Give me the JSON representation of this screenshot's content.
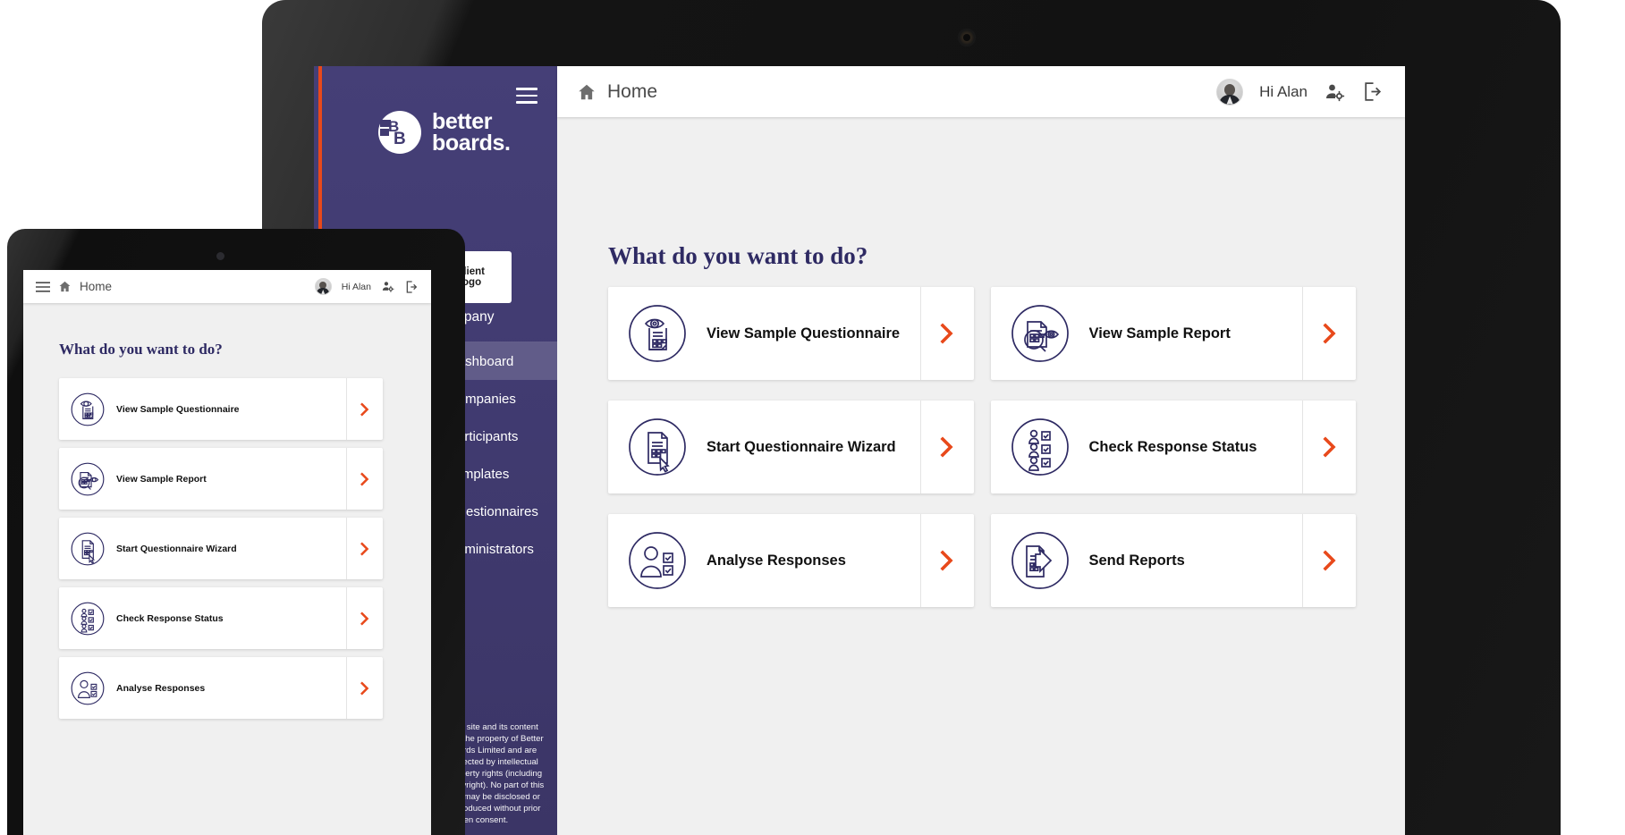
{
  "brand": {
    "name_line1": "better",
    "name_line2": "boards.",
    "mark_letters": "BB",
    "client_logo_label": "Client Logo",
    "accent_color": "#e8491b",
    "sidebar_color": "#413b71",
    "heading_color": "#2e2a63"
  },
  "laptop": {
    "topbar": {
      "breadcrumb": "Home",
      "greeting": "Hi Alan",
      "home_icon": "home-icon",
      "user_settings_icon": "user-settings-icon",
      "logout_icon": "logout-icon",
      "menu_icon": "hamburger-menu-icon"
    },
    "sidebar": {
      "selected_company": "Selected Company",
      "items": [
        {
          "label": "Dashboard",
          "active": true
        },
        {
          "label": "Companies",
          "active": false
        },
        {
          "label": "Participants",
          "active": false
        },
        {
          "label": "Templates",
          "active": false
        },
        {
          "label": "Questionnaires",
          "active": false
        },
        {
          "label": "Administrators",
          "active": false
        }
      ],
      "footer": "This site and its content are the property of Better Boards Limited and are protected by intellectual property rights (including copyright). No part of this site may be disclosed or reproduced without prior written consent."
    },
    "main": {
      "title": "What do you want to do?",
      "cards": [
        {
          "label": "View Sample Questionnaire",
          "icon": "eye-document-icon"
        },
        {
          "label": "View Sample Report",
          "icon": "report-magnifier-eye-icon"
        },
        {
          "label": "Start Questionnaire Wizard",
          "icon": "document-cursor-icon"
        },
        {
          "label": "Check Response Status",
          "icon": "people-checklist-icon"
        },
        {
          "label": "Analyse Responses",
          "icon": "person-checkboxes-icon"
        },
        {
          "label": "Send Reports",
          "icon": "document-arrow-icon"
        }
      ],
      "arrow_icon": "chevron-right-icon"
    }
  },
  "tablet": {
    "topbar": {
      "breadcrumb": "Home",
      "greeting": "Hi Alan",
      "menu_icon": "hamburger-menu-icon",
      "home_icon": "home-icon",
      "user_settings_icon": "user-settings-icon",
      "logout_icon": "logout-icon"
    },
    "main": {
      "title": "What do you want to do?",
      "cards": [
        {
          "label": "View Sample Questionnaire",
          "icon": "eye-document-icon"
        },
        {
          "label": "View Sample Report",
          "icon": "report-magnifier-eye-icon"
        },
        {
          "label": "Start Questionnaire Wizard",
          "icon": "document-cursor-icon"
        },
        {
          "label": "Check Response Status",
          "icon": "people-checklist-icon"
        },
        {
          "label": "Analyse Responses",
          "icon": "person-checkboxes-icon"
        }
      ],
      "arrow_icon": "chevron-right-icon"
    }
  }
}
